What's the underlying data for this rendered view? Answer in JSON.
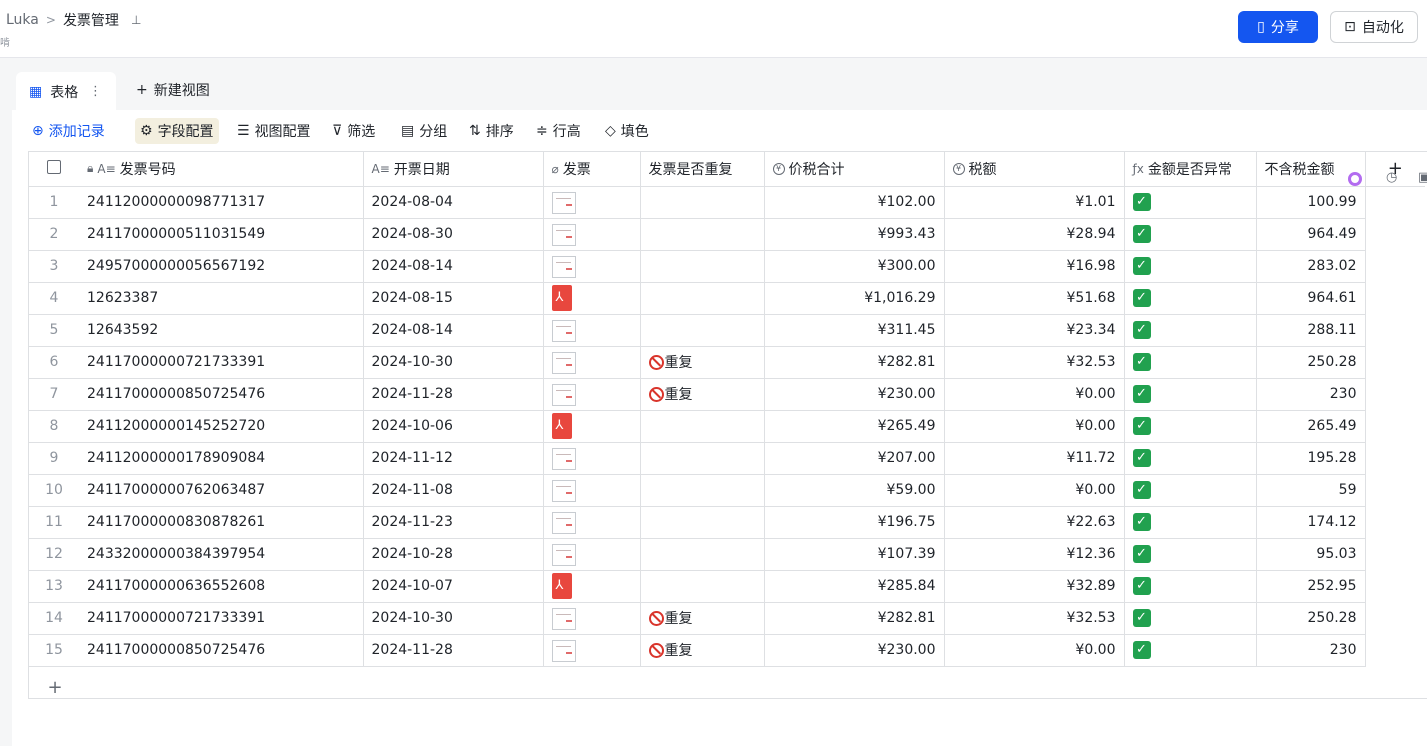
{
  "breadcrumb": {
    "root": "Luka",
    "separator": ">",
    "current": "发票管理",
    "subline": "啃"
  },
  "header": {
    "share_label": "分享",
    "automation_label": "自动化"
  },
  "tabs": {
    "active_label": "表格",
    "new_view_label": "新建视图"
  },
  "toolbar": {
    "add_record": "添加记录",
    "field_config": "字段配置",
    "view_config": "视图配置",
    "filter": "筛选",
    "group": "分组",
    "sort": "排序",
    "row_height": "行高",
    "fill_color": "填色"
  },
  "columns": {
    "invoice_no": "发票号码",
    "date": "开票日期",
    "invoice": "发票",
    "duplicate": "发票是否重复",
    "total": "价税合计",
    "tax": "税额",
    "abnormal": "金额是否异常",
    "net": "不含税金额"
  },
  "rows": [
    {
      "idx": "1",
      "invoice_no": "24112000000098771317",
      "date": "2024-08-04",
      "file": "image",
      "dup": "",
      "total": "¥102.00",
      "tax": "¥1.01",
      "ok": true,
      "net": "100.99"
    },
    {
      "idx": "2",
      "invoice_no": "24117000000511031549",
      "date": "2024-08-30",
      "file": "image",
      "dup": "",
      "total": "¥993.43",
      "tax": "¥28.94",
      "ok": true,
      "net": "964.49"
    },
    {
      "idx": "3",
      "invoice_no": "24957000000056567192",
      "date": "2024-08-14",
      "file": "image",
      "dup": "",
      "total": "¥300.00",
      "tax": "¥16.98",
      "ok": true,
      "net": "283.02"
    },
    {
      "idx": "4",
      "invoice_no": "12623387",
      "date": "2024-08-15",
      "file": "pdf",
      "dup": "",
      "total": "¥1,016.29",
      "tax": "¥51.68",
      "ok": true,
      "net": "964.61"
    },
    {
      "idx": "5",
      "invoice_no": "12643592",
      "date": "2024-08-14",
      "file": "image",
      "dup": "",
      "total": "¥311.45",
      "tax": "¥23.34",
      "ok": true,
      "net": "288.11"
    },
    {
      "idx": "6",
      "invoice_no": "24117000000721733391",
      "date": "2024-10-30",
      "file": "image",
      "dup": "重复",
      "total": "¥282.81",
      "tax": "¥32.53",
      "ok": true,
      "net": "250.28"
    },
    {
      "idx": "7",
      "invoice_no": "24117000000850725476",
      "date": "2024-11-28",
      "file": "image",
      "dup": "重复",
      "total": "¥230.00",
      "tax": "¥0.00",
      "ok": true,
      "net": "230"
    },
    {
      "idx": "8",
      "invoice_no": "24112000000145252720",
      "date": "2024-10-06",
      "file": "pdf",
      "dup": "",
      "total": "¥265.49",
      "tax": "¥0.00",
      "ok": true,
      "net": "265.49"
    },
    {
      "idx": "9",
      "invoice_no": "24112000000178909084",
      "date": "2024-11-12",
      "file": "image",
      "dup": "",
      "total": "¥207.00",
      "tax": "¥11.72",
      "ok": true,
      "net": "195.28"
    },
    {
      "idx": "10",
      "invoice_no": "24117000000762063487",
      "date": "2024-11-08",
      "file": "image",
      "dup": "",
      "total": "¥59.00",
      "tax": "¥0.00",
      "ok": true,
      "net": "59"
    },
    {
      "idx": "11",
      "invoice_no": "24117000000830878261",
      "date": "2024-11-23",
      "file": "image",
      "dup": "",
      "total": "¥196.75",
      "tax": "¥22.63",
      "ok": true,
      "net": "174.12"
    },
    {
      "idx": "12",
      "invoice_no": "24332000000384397954",
      "date": "2024-10-28",
      "file": "image",
      "dup": "",
      "total": "¥107.39",
      "tax": "¥12.36",
      "ok": true,
      "net": "95.03"
    },
    {
      "idx": "13",
      "invoice_no": "24117000000636552608",
      "date": "2024-10-07",
      "file": "pdf",
      "dup": "",
      "total": "¥285.84",
      "tax": "¥32.89",
      "ok": true,
      "net": "252.95"
    },
    {
      "idx": "14",
      "invoice_no": "24117000000721733391",
      "date": "2024-10-30",
      "file": "image",
      "dup": "重复",
      "total": "¥282.81",
      "tax": "¥32.53",
      "ok": true,
      "net": "250.28"
    },
    {
      "idx": "15",
      "invoice_no": "24117000000850725476",
      "date": "2024-11-28",
      "file": "image",
      "dup": "重复",
      "total": "¥230.00",
      "tax": "¥0.00",
      "ok": true,
      "net": "230"
    }
  ],
  "colors": {
    "accent": "#1456f0",
    "check_green": "#21a14f",
    "pdf_red": "#e8473e",
    "dup_red": "#d9342b"
  }
}
